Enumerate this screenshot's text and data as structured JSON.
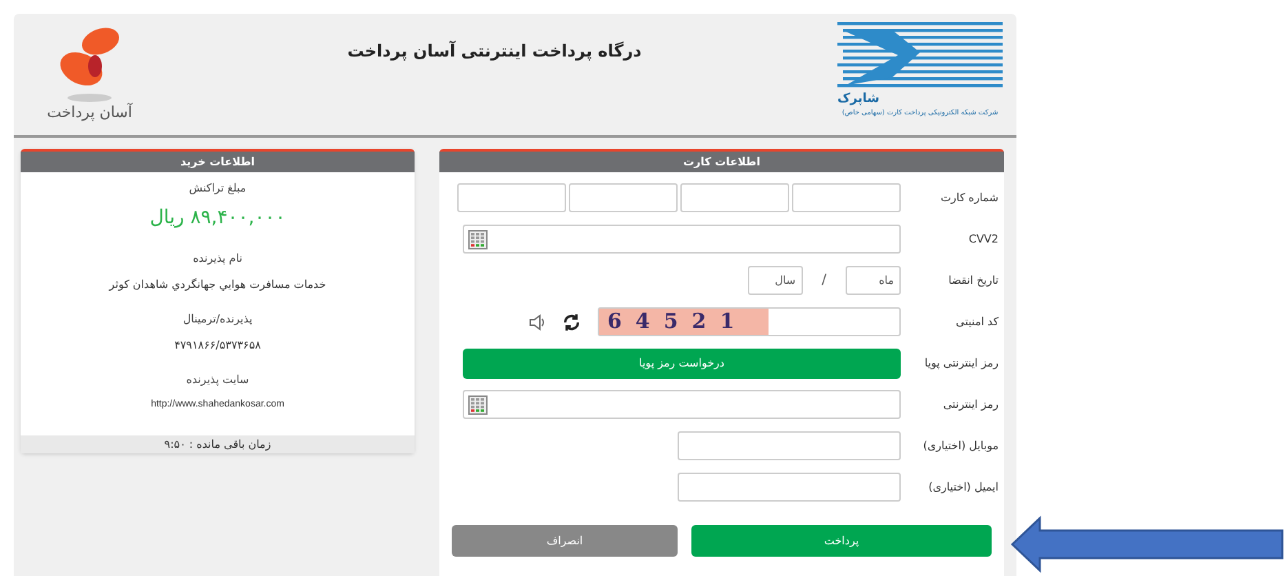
{
  "header": {
    "title": "درگاه پرداخت اینترنتی آسان پرداخت",
    "left_logo_text": "آسان پرداخت",
    "right_logo_text": "شاپرک",
    "right_logo_caption": "شرکت شبکه الکترونیکی پرداخت کارت (سهامی خاص)"
  },
  "purchase_info": {
    "title": "اطلاعات خرید",
    "fields": [
      {
        "label": "مبلغ تراکنش",
        "value": "۸۹,۴۰۰,۰۰۰ ریال",
        "kind": "amount"
      },
      {
        "label": "نام پذیرنده",
        "value": "خدمات مسافرت هوايي جهانگردي شاهدان کوثر",
        "kind": "text"
      },
      {
        "label": "پذیرنده/ترمینال",
        "value": "۴۷۹۱۸۶۶/۵۳۷۳۶۵۸",
        "kind": "text"
      },
      {
        "label": "سایت پذیرنده",
        "value": "http://www.shahedankosar.com",
        "kind": "url"
      }
    ],
    "timer": "زمان باقی مانده : ۹:۵۰"
  },
  "card_info": {
    "title": "اطلاعات کارت",
    "rows": [
      {
        "kind": "card_number",
        "label": "شماره کارت"
      },
      {
        "kind": "keypad_input",
        "label": "CVV2"
      },
      {
        "kind": "expiry",
        "label": "تاریخ انقضا",
        "month_placeholder": "ماه",
        "separator": "/",
        "year_placeholder": "سال"
      },
      {
        "kind": "captcha",
        "label": "کد امنیتی",
        "captcha": "64521"
      },
      {
        "kind": "button",
        "label": "رمز اینترنتی پویا",
        "button": "درخواست رمز پویا"
      },
      {
        "kind": "keypad_input",
        "label": "رمز اینترنتی"
      },
      {
        "kind": "short_input",
        "label": "موبایل (اختیاری)"
      },
      {
        "kind": "short_input",
        "label": "ایمیل (اختیاری)"
      }
    ],
    "buttons": [
      {
        "label": "پرداخت",
        "kind": "primary"
      },
      {
        "label": "انصراف",
        "kind": "secondary"
      }
    ]
  }
}
